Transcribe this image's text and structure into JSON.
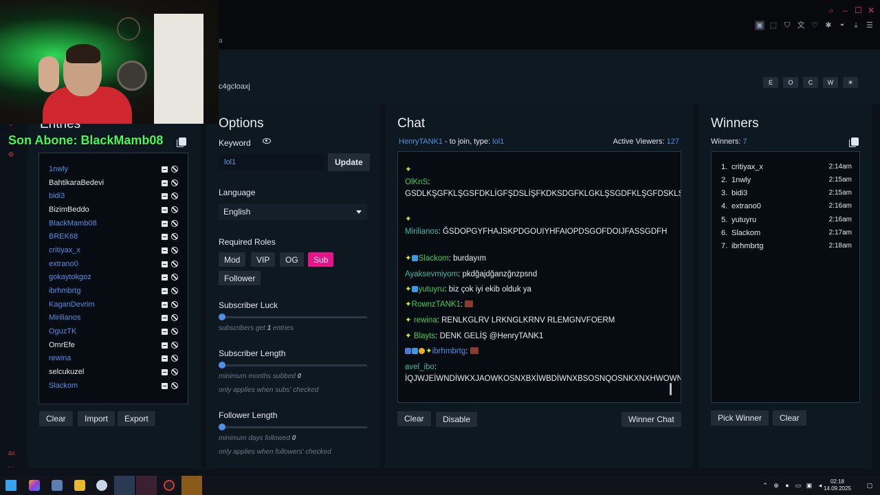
{
  "browser": {
    "url_fragment": "a"
  },
  "header": {
    "giveaway_id": "c4gcloaxj",
    "view_buttons": [
      "E",
      "O",
      "C",
      "W",
      "☀"
    ]
  },
  "overlay": {
    "sub_alert": "Son Abone: BlackMamb08"
  },
  "entries": {
    "title": "Entries",
    "items": [
      {
        "name": "1nwly",
        "color": "blue"
      },
      {
        "name": "BahtikaraBedevi",
        "color": "white"
      },
      {
        "name": "bidi3",
        "color": "blue"
      },
      {
        "name": "BizimBeddo",
        "color": "white"
      },
      {
        "name": "BlackMamb08",
        "color": "blue"
      },
      {
        "name": "BREK68",
        "color": "blue"
      },
      {
        "name": "critiyax_x",
        "color": "blue"
      },
      {
        "name": "extrano0",
        "color": "blue"
      },
      {
        "name": "gokaytokgoz",
        "color": "blue"
      },
      {
        "name": "ibrhmbrtg",
        "color": "blue"
      },
      {
        "name": "KaganDevrim",
        "color": "blue"
      },
      {
        "name": "Mirilianos",
        "color": "blue"
      },
      {
        "name": "OguzTK",
        "color": "blue"
      },
      {
        "name": "OmrEfe",
        "color": "white"
      },
      {
        "name": "rewina",
        "color": "blue"
      },
      {
        "name": "selcukuzel",
        "color": "white"
      },
      {
        "name": "Slackom",
        "color": "blue"
      }
    ],
    "buttons": {
      "clear": "Clear",
      "import": "Import",
      "export": "Export"
    }
  },
  "options": {
    "title": "Options",
    "keyword_label": "Keyword",
    "keyword_value": "lol1",
    "update_label": "Update",
    "language_label": "Language",
    "language_value": "English",
    "roles_label": "Required Roles",
    "roles": [
      {
        "label": "Mod",
        "on": false
      },
      {
        "label": "VIP",
        "on": false
      },
      {
        "label": "OG",
        "on": false
      },
      {
        "label": "Sub",
        "on": true
      },
      {
        "label": "Follower",
        "on": false
      }
    ],
    "subscriber_luck": {
      "label": "Subscriber Luck",
      "hint_pre": "subscribers get ",
      "value": "1",
      "hint_post": " entries",
      "level": 0
    },
    "subscriber_length": {
      "label": "Subscriber Length",
      "hint_pre": "minimum months subbed ",
      "value": "0",
      "hint2": "only applies when subs' checked",
      "level": 0
    },
    "follower_length": {
      "label": "Follower Length",
      "hint_pre": "minimum days followed ",
      "value": "0",
      "hint2": "only applies when followers' checked",
      "level": 0
    }
  },
  "chat": {
    "title": "Chat",
    "join_user": "HenryTANK1",
    "join_text": " - to join, type: ",
    "join_keyword": "lol1",
    "viewers_label": "Active Viewers: ",
    "viewers_count": "127",
    "messages": [
      {
        "user": "OlKnS",
        "text": "GSDLKŞGFKLŞGSFDKLİGFŞDSLİŞFKDKSDGFKLGKLŞSGDFKLŞGFDSKLŞDSGFKLŞİLGKDSFGSFKDLŞGŞKSGFLDKLŞFDKGLŞGKLŞDKLŞ",
        "cls": "green"
      },
      {
        "user": "Mirilianos",
        "text": "ĞSDOPGYFHAJSKPDGOUIYHFAIOPDSGOFDOIJFASSGDFH",
        "cls": "teal"
      },
      {
        "user": "Slackom",
        "text": "burdayım",
        "cls": "green"
      },
      {
        "user": "Ayaksevmiyom",
        "text": "pkdğajdğanzğnzpsnd",
        "cls": "teal"
      },
      {
        "user": "yutuyru",
        "text": "biz çok iyi ekib olduk ya",
        "cls": "green"
      },
      {
        "user": "RownzTANK1",
        "text": "",
        "cls": "green"
      },
      {
        "user": "rewina",
        "text": "RENLKGLRV LRKNGLKRNV RLEMGNVFOERM",
        "cls": "green"
      },
      {
        "user": "Blayts",
        "text": "DENK GELİŞ @HenryTANK1",
        "cls": "green"
      },
      {
        "user": "ibrhmbrtg",
        "text": "",
        "cls": ""
      },
      {
        "user": "avel_ibo",
        "text": "İQJWJEİWNDİWKXJAOWKOSNXBXİWBDİWNXBSOSNQOSNKXNXHWOWNOWKSKSOQMSKSOSNOSNDJSKANSİFHSOMQAMKW.A",
        "cls": "teal"
      }
    ],
    "buttons": {
      "clear": "Clear",
      "disable": "Disable",
      "winner_chat": "Winner Chat"
    }
  },
  "winners": {
    "title": "Winners",
    "count_label": "Winners: ",
    "count": "7",
    "items": [
      {
        "idx": "1.",
        "name": "critiyax_x",
        "time": "2:14am"
      },
      {
        "idx": "2.",
        "name": "1nwly",
        "time": "2:15am"
      },
      {
        "idx": "3.",
        "name": "bidi3",
        "time": "2:15am"
      },
      {
        "idx": "4.",
        "name": "extrano0",
        "time": "2:16am"
      },
      {
        "idx": "5.",
        "name": "yutuyru",
        "time": "2:16am"
      },
      {
        "idx": "6.",
        "name": "Slackom",
        "time": "2:17am"
      },
      {
        "idx": "7.",
        "name": "ibrhmbrtg",
        "time": "2:18am"
      }
    ],
    "buttons": {
      "pick": "Pick Winner",
      "clear": "Clear"
    }
  },
  "taskbar": {
    "time": "02:18",
    "date": "14.09.2025"
  },
  "colors": {
    "accent_blue": "#4f8fe8",
    "sub_pink": "#e6148a",
    "bg": "#0b1219",
    "panel": "#0e1821"
  }
}
